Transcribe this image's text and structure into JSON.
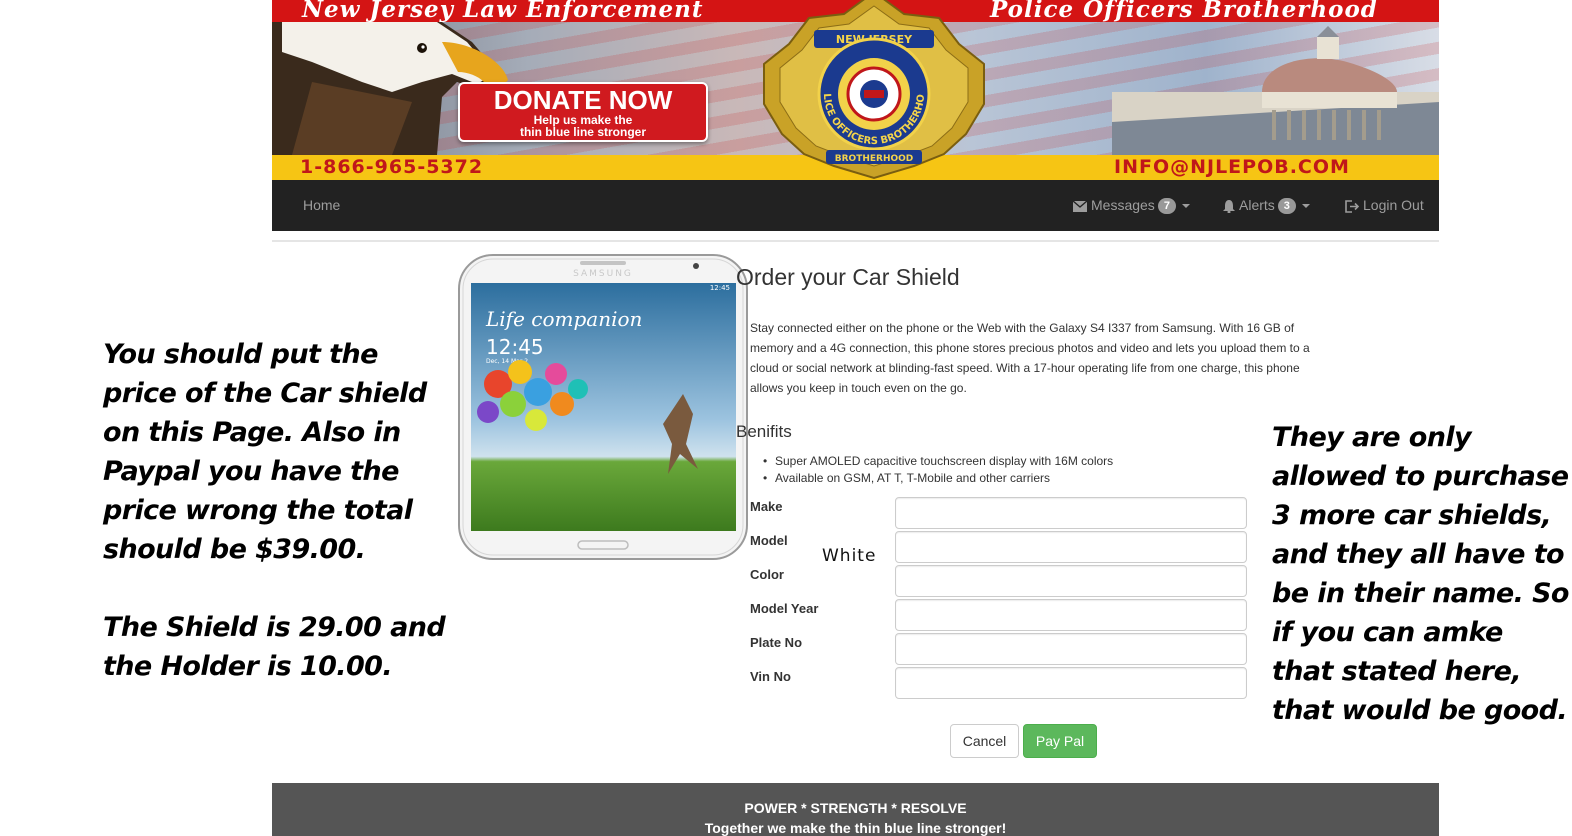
{
  "banner": {
    "title_left": "New Jersey Law Enforcement",
    "title_right": "Police Officers Brotherhood",
    "phone": "1-866-965-5372",
    "email": "INFO@NJLEPOB.COM",
    "donate_title": "DONATE NOW",
    "donate_sub1": "Help us make the",
    "donate_sub2": "thin blue line stronger",
    "badge_top": "NEW JERSEY",
    "badge_ring": "POLICE OFFICERS BROTHERHOOD",
    "badge_bottom": "BROTHERHOOD"
  },
  "nav": {
    "home": "Home",
    "messages": "Messages",
    "messages_count": "7",
    "alerts": "Alerts",
    "alerts_count": "3",
    "logout": "Login Out"
  },
  "phone": {
    "brand": "SAMSUNG",
    "status_time": "12:45",
    "tagline": "Life companion",
    "clock": "12:45",
    "date": "Dec, 14 Mar 2"
  },
  "main": {
    "title": "Order your Car Shield",
    "description": "Stay connected either on the phone or the Web with the Galaxy S4 I337 from Samsung. With 16 GB of memory and a 4G connection, this phone stores precious photos and video and lets you upload them to a cloud or social network at blinding-fast speed. With a 17-hour operating life from one charge, this phone allows you keep in touch even on the go.",
    "benefits_title": "Benifits",
    "benefits": [
      "Super AMOLED capacitive touchscreen display with 16M colors",
      "Available on GSM, AT T, T-Mobile and other carriers"
    ],
    "form": {
      "make_label": "Make",
      "model_label": "Model",
      "color_label": "Color",
      "model_year_label": "Model Year",
      "plate_label": "Plate No",
      "vin_label": "Vin No",
      "make_value": "",
      "model_value": "",
      "color_value": "",
      "model_year_value": "",
      "plate_value": "",
      "vin_value": "",
      "white_note": "White"
    },
    "cancel_label": "Cancel",
    "paypal_label": "Pay Pal"
  },
  "notes": {
    "left_p1": "You should put the price of the Car shield on this Page. Also in Paypal you have the price wrong the total should be $39.00.",
    "left_p2": "The Shield is 29.00 and the Holder is 10.00.",
    "right": "They are only allowed to purchase 3 more car shields, and they all have to be in their name. So if you can amke that stated here, that would be good."
  },
  "footer": {
    "line1": "POWER * STRENGTH * RESOLVE",
    "line2": "Together we make the thin blue line stronger!"
  },
  "colors": {
    "banner_red": "#d41414",
    "banner_yellow": "#f6c514",
    "navbar": "#222222",
    "paypal_green": "#5cb85c",
    "footer": "#555555"
  }
}
